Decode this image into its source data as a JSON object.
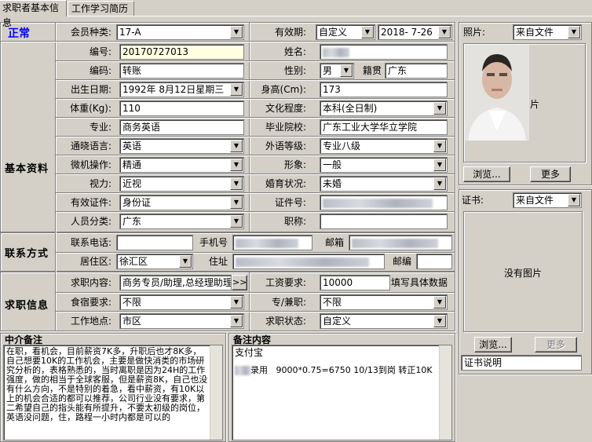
{
  "tabs": [
    "求职者基本信息",
    "工作学习简历"
  ],
  "status": "正常",
  "sections": {
    "basic": "基本资料",
    "contact": "联系方式",
    "job": "求职信息"
  },
  "labels": {
    "member_type": "会员种类:",
    "validity": "有效期:",
    "number": "编号:",
    "name": "姓名:",
    "code": "编码:",
    "gender": "性别:",
    "origin": "籍贯",
    "birth": "出生日期:",
    "height": "身高(Cm):",
    "weight": "体重(Kg):",
    "education": "文化程度:",
    "major": "专业:",
    "school": "毕业院校:",
    "language": "通晓语言:",
    "foreign_level": "外语等级:",
    "computer": "微机操作:",
    "appearance": "形象:",
    "vision": "视力:",
    "marriage": "婚育状况:",
    "id_type": "有效证件:",
    "id_no": "证件号:",
    "category": "人员分类:",
    "title": "职称:",
    "phone": "联系电话:",
    "mobile": "手机号",
    "email": "邮箱",
    "district": "居住区:",
    "address": "住址",
    "zip": "邮编",
    "job_want": "求职内容:",
    "salary": "工资要求:",
    "salary_hint": "填写具体数据",
    "food": "食宿要求:",
    "parttime": "专/兼职:",
    "location": "工作地点:",
    "job_status": "求职状态:",
    "photo": "照片:",
    "cert": "证书:",
    "agent_notes": "中介备注",
    "remarks": "备注内容"
  },
  "values": {
    "member_type": "17-A",
    "validity_type": "自定义",
    "validity_date": "2018- 7-26",
    "number": "20170727013",
    "code": "转账",
    "gender": "男",
    "origin": "广东",
    "birth": "1992年 8月12日星期三",
    "height": "173",
    "weight": "110",
    "education": "本科(全日制)",
    "major": "商务英语",
    "school": "广东工业大学华立学院",
    "language": "英语",
    "foreign_level": "专业八级",
    "computer": "精通",
    "appearance": "一般",
    "vision": "近视",
    "marriage": "未婚",
    "id_type": "身份证",
    "category": "广东",
    "district": "徐汇区",
    "job_want": "商务专员/助理,总经理助理",
    "salary": "10000",
    "food": "不限",
    "parttime": "不限",
    "location": "市区",
    "job_status": "自定义",
    "photo_src": "来自文件",
    "cert_src": "来自文件"
  },
  "buttons": {
    "more_arrow": ">>",
    "browse": "浏览...",
    "more": "更多"
  },
  "photo_partial_text": "片",
  "cert_empty": "没有图片",
  "cert_desc": "证书说明",
  "agent_notes_text": "在职，看机会，目前薪资7K多，升职后也才8K多，自己想要10K的工作机会，主要是做快消类的市场研究分析的，表格熟悉的，当时离职是因为24H的工作强度，做的相当于全球客服，但是薪资8K，自己也没有什么方向，不是特别的着急，看中薪资，有10K以上的机会合适的都可以推荐，公司行业没有要求，第二希望自己的指头能有所提升，不要太初级的岗位，英语没问题，住，路程一小时内都是可以的",
  "remarks": {
    "line1": "支付宝",
    "line2_pre": "录用",
    "line2": "9000*0.75=6750 10/13到岗  转正10K"
  }
}
